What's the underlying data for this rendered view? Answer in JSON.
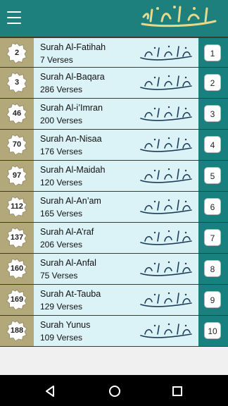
{
  "app": {
    "title": "تجوید قرآن",
    "colors": {
      "topbar": "#1d807c",
      "left_strip": "#b2a87a",
      "right_strip": "#18817f",
      "row_bg": "#dbf2f6"
    }
  },
  "surahs": [
    {
      "left_number": "2",
      "name": "Surah Al-Fatihah",
      "verses": "7 Verses",
      "index": "1",
      "arabic": "سُوۡرَۃُ الۡفَاتِحَة"
    },
    {
      "left_number": "3",
      "name": "Surah Al-Baqara",
      "verses": "286 Verses",
      "index": "2",
      "arabic": "سُوۡرَۃُ البَقَرَة"
    },
    {
      "left_number": "46",
      "name": "Surah Al-i’Imran",
      "verses": "200 Verses",
      "index": "3",
      "arabic": "سُوۡرَۃُ اٰلِ عِمۡرَان"
    },
    {
      "left_number": "70",
      "name": "Surah An-Nisaa",
      "verses": "176 Verses",
      "index": "4",
      "arabic": "سُوۡرَۃُ النِّسَاء"
    },
    {
      "left_number": "97",
      "name": "Surah Al-Maidah",
      "verses": "120 Verses",
      "index": "5",
      "arabic": "سُوۡرَۃُ المَائِدَة"
    },
    {
      "left_number": "112",
      "name": "Surah Al-An’am",
      "verses": "165 Verses",
      "index": "6",
      "arabic": "سُوۡرَۃُ الاَنۡعَام"
    },
    {
      "left_number": "137",
      "name": "Surah Al-A’raf",
      "verses": "206 Verses",
      "index": "7",
      "arabic": "سُوۡرَۃُ الاَعۡرَاف"
    },
    {
      "left_number": "160",
      "name": "Surah Al-Anfal",
      "verses": "75 Verses",
      "index": "8",
      "arabic": "سُوۡرَۃُ الاَنۡفَال"
    },
    {
      "left_number": "169",
      "name": "Surah At-Tauba",
      "verses": "129 Verses",
      "index": "9",
      "arabic": "سُوۡرَۃُ التَّوۡبَة"
    },
    {
      "left_number": "188",
      "name": "Surah Yunus",
      "verses": "109 Verses",
      "index": "10",
      "arabic": "سُوۡرَۃُ يُوۡنُس"
    }
  ],
  "icons": {
    "menu": "hamburger-menu-icon",
    "back": "back-triangle-icon",
    "home": "home-circle-icon",
    "recent": "recent-square-icon"
  }
}
